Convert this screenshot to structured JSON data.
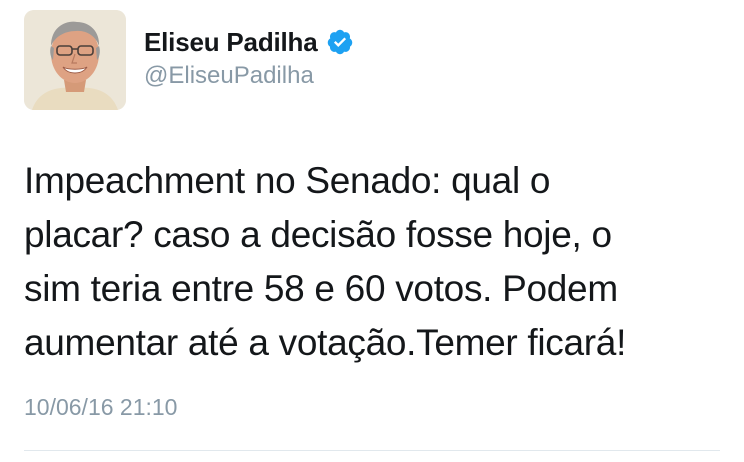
{
  "tweet": {
    "author": {
      "display_name": "Eliseu Padilha",
      "handle": "@EliseuPadilha",
      "verified_icon": "verified-badge-icon",
      "avatar": "profile-photo"
    },
    "text_lines": [
      "Impeachment no Senado: qual o",
      "placar? caso a decisão fosse hoje, o",
      "sim teria entre 58 e 60 votos. Podem",
      "aumentar até a votação.Temer ficará!"
    ],
    "timestamp": "10/06/16 21:10"
  },
  "colors": {
    "verified_blue": "#1da1f2",
    "muted_text": "#8899a6",
    "text": "#14171a",
    "divider": "#e1e8ed"
  }
}
